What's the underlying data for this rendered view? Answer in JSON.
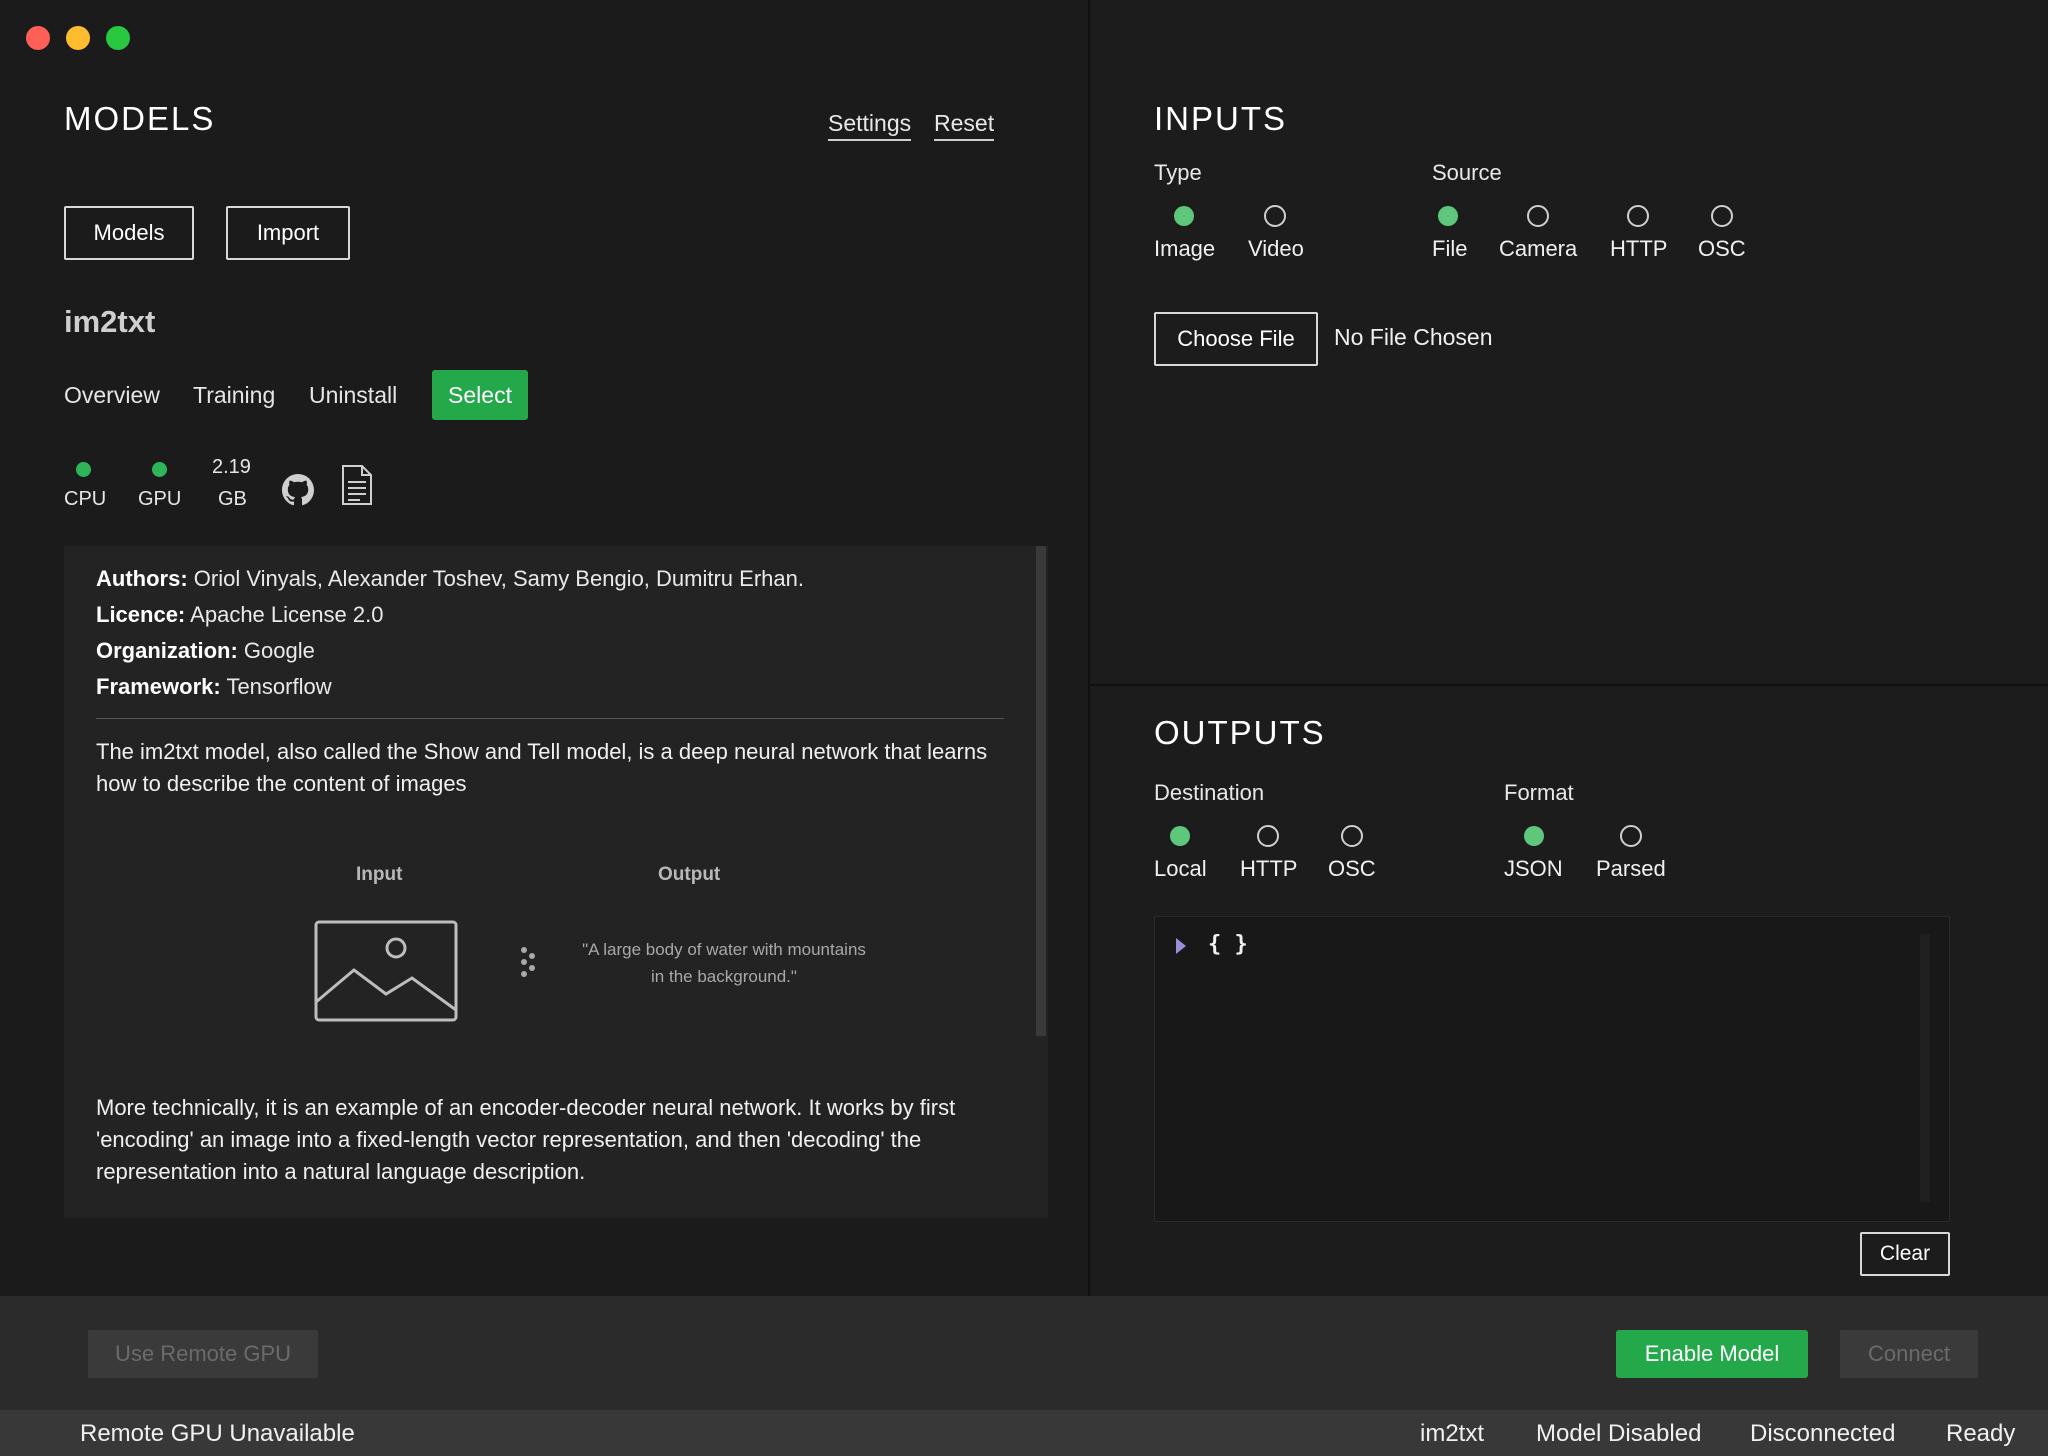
{
  "window": {
    "controls": [
      "close",
      "minimize",
      "maximize"
    ]
  },
  "models": {
    "title": "MODELS",
    "links": {
      "settings": "Settings",
      "reset": "Reset"
    },
    "buttons": {
      "models": "Models",
      "import": "Import"
    },
    "model_name": "im2txt",
    "tabs": [
      "Overview",
      "Training",
      "Uninstall"
    ],
    "select_label": "Select",
    "hardware": {
      "cpu_label": "CPU",
      "gpu_label": "GPU",
      "size_value": "2.19",
      "size_unit": "GB"
    },
    "icons": [
      "github-icon",
      "document-icon"
    ]
  },
  "info": {
    "authors_key": "Authors:",
    "authors_val": "Oriol Vinyals, Alexander Toshev, Samy Bengio, Dumitru Erhan.",
    "licence_key": "Licence:",
    "licence_val": "Apache License 2.0",
    "org_key": "Organization:",
    "org_val": "Google",
    "framework_key": "Framework:",
    "framework_val": "Tensorflow",
    "description": "The im2txt model, also called the Show and Tell model, is a deep neural network that learns how to describe the content of images",
    "diagram": {
      "input_label": "Input",
      "output_label": "Output",
      "output_text": "\"A large body of water with mountains in the background.\""
    },
    "technical": "More technically, it is an example of an encoder-decoder neural network. It works by first 'encoding' an image into a fixed-length vector representation, and then 'decoding' the representation into a natural language description."
  },
  "inputs": {
    "title": "INPUTS",
    "type_label": "Type",
    "type_options": [
      "Image",
      "Video"
    ],
    "type_selected": "Image",
    "source_label": "Source",
    "source_options": [
      "File",
      "Camera",
      "HTTP",
      "OSC"
    ],
    "source_selected": "File",
    "choose_file": "Choose File",
    "file_status": "No File Chosen"
  },
  "outputs": {
    "title": "OUTPUTS",
    "destination_label": "Destination",
    "destination_options": [
      "Local",
      "HTTP",
      "OSC"
    ],
    "destination_selected": "Local",
    "format_label": "Format",
    "format_options": [
      "JSON",
      "Parsed"
    ],
    "format_selected": "JSON",
    "json_preview": "{ }",
    "clear": "Clear"
  },
  "actions": {
    "use_remote_gpu": "Use Remote GPU",
    "enable_model": "Enable Model",
    "connect": "Connect"
  },
  "status": {
    "left": "Remote GPU Unavailable",
    "model": "im2txt",
    "model_state": "Model Disabled",
    "connection": "Disconnected",
    "ready": "Ready"
  },
  "colors": {
    "accent_green": "#23a84a",
    "radio_green": "#5ec77c",
    "background": "#1b1b1b"
  }
}
